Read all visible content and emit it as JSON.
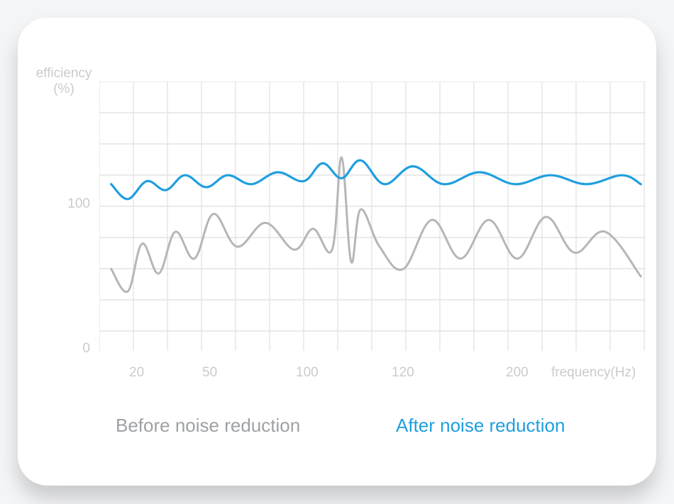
{
  "chart_data": {
    "type": "line",
    "title": "",
    "xlabel": "frequency(Hz)",
    "ylabel": "efficiency\n(%)",
    "y_ticks": [
      0,
      100
    ],
    "x_ticks": [
      20,
      50,
      100,
      120,
      200
    ],
    "ylim": [
      0,
      200
    ],
    "series": [
      {
        "name": "Before noise reduction",
        "color": "#b4b6b9",
        "x": [
          15,
          22,
          28,
          35,
          42,
          50,
          58,
          68,
          80,
          92,
          100,
          108,
          112,
          116,
          120,
          128,
          138,
          150,
          162,
          174,
          186,
          198,
          210,
          223,
          238
        ],
        "y": [
          55,
          40,
          72,
          52,
          80,
          62,
          92,
          70,
          86,
          68,
          82,
          68,
          130,
          60,
          95,
          70,
          55,
          88,
          62,
          88,
          62,
          90,
          66,
          80,
          50
        ]
      },
      {
        "name": "After noise reduction",
        "color": "#1f9fde",
        "x": [
          15,
          22,
          30,
          38,
          46,
          55,
          64,
          74,
          85,
          96,
          104,
          112,
          120,
          130,
          142,
          155,
          170,
          185,
          200,
          215,
          230,
          238
        ],
        "y": [
          112,
          102,
          114,
          108,
          118,
          110,
          118,
          112,
          120,
          114,
          126,
          116,
          128,
          112,
          124,
          112,
          120,
          112,
          118,
          112,
          118,
          112
        ]
      }
    ]
  },
  "axis": {
    "ylabel_line1": "efficiency",
    "ylabel_line2": "(%)",
    "xlabel": "frequency(Hz)",
    "ytick_0_label": "0",
    "ytick_100_label": "100",
    "xtick_labels": {
      "t0": "20",
      "t1": "50",
      "t2": "100",
      "t3": "120",
      "t4": "200"
    }
  },
  "legend": {
    "before": "Before noise reduction",
    "after": "After noise reduction"
  }
}
